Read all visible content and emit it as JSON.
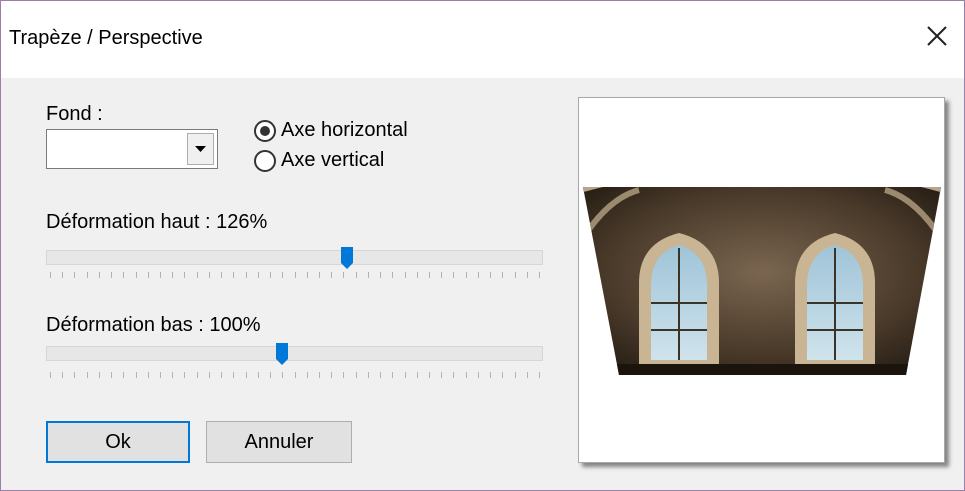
{
  "window": {
    "title": "Trapèze / Perspective"
  },
  "fond": {
    "label": "Fond :",
    "value": ""
  },
  "axis": {
    "options": [
      "Axe horizontal",
      "Axe vertical"
    ],
    "selected": "Axe horizontal"
  },
  "sliders": [
    {
      "label": "Déformation haut : 126%",
      "value_percent": 126,
      "position_fraction": 0.61
    },
    {
      "label": "Déformation bas : 100%",
      "value_percent": 100,
      "position_fraction": 0.47
    }
  ],
  "buttons": {
    "ok": "Ok",
    "cancel": "Annuler"
  },
  "colors": {
    "accent": "#0078d7",
    "window_border": "#9b7fa8",
    "face": "#f0f0f0"
  },
  "icons": {
    "close": "close-icon",
    "dropdown": "chevron-down-icon"
  }
}
